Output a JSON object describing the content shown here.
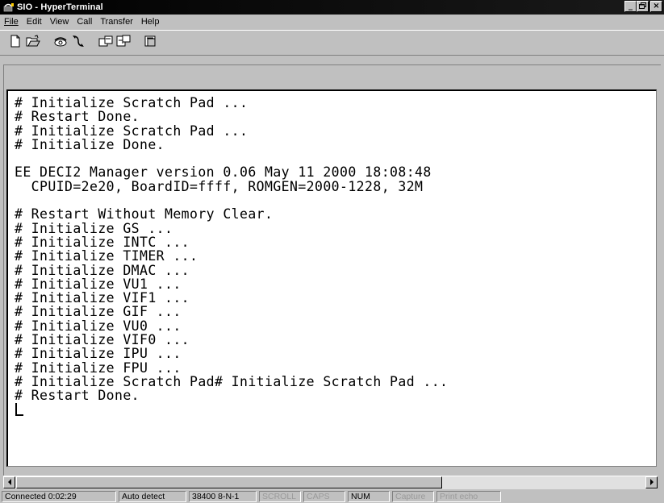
{
  "window": {
    "title": "SIO - HyperTerminal",
    "icon": "hyperterminal-phone-icon",
    "controls": {
      "minimize": "_",
      "maximize": "□",
      "close": "×"
    }
  },
  "menu": {
    "items": [
      {
        "label": "File",
        "underline": "F"
      },
      {
        "label": "Edit",
        "underline": "E"
      },
      {
        "label": "View",
        "underline": "V"
      },
      {
        "label": "Call",
        "underline": "C"
      },
      {
        "label": "Transfer",
        "underline": "T"
      },
      {
        "label": "Help",
        "underline": "H"
      }
    ]
  },
  "toolbar": {
    "buttons": [
      {
        "icon": "new-document-icon"
      },
      {
        "icon": "open-folder-icon"
      },
      {
        "icon": "connect-phone-icon"
      },
      {
        "icon": "disconnect-phone-icon"
      },
      {
        "icon": "send-file-icon"
      },
      {
        "icon": "receive-file-icon"
      },
      {
        "icon": "properties-icon"
      }
    ]
  },
  "terminal": {
    "lines": [
      "# Initialize Scratch Pad ...",
      "# Restart Done.",
      "# Initialize Scratch Pad ...",
      "# Initialize Done.",
      "",
      "EE DECI2 Manager version 0.06 May 11 2000 18:08:48",
      "  CPUID=2e20, BoardID=ffff, ROMGEN=2000-1228, 32M",
      "",
      "# Restart Without Memory Clear.",
      "# Initialize GS ...",
      "# Initialize INTC ...",
      "# Initialize TIMER ...",
      "# Initialize DMAC ...",
      "# Initialize VU1 ...",
      "# Initialize VIF1 ...",
      "# Initialize GIF ...",
      "# Initialize VU0 ...",
      "# Initialize VIF0 ...",
      "# Initialize IPU ...",
      "# Initialize FPU ...",
      "# Initialize Scratch Pad# Initialize Scratch Pad ...",
      "# Restart Done."
    ]
  },
  "statusbar": {
    "connected": "Connected 0:02:29",
    "detect": "Auto detect",
    "settings": "38400 8-N-1",
    "scroll": "SCROLL",
    "caps": "CAPS",
    "num": "NUM",
    "capture": "Capture",
    "print_echo": "Print echo"
  }
}
